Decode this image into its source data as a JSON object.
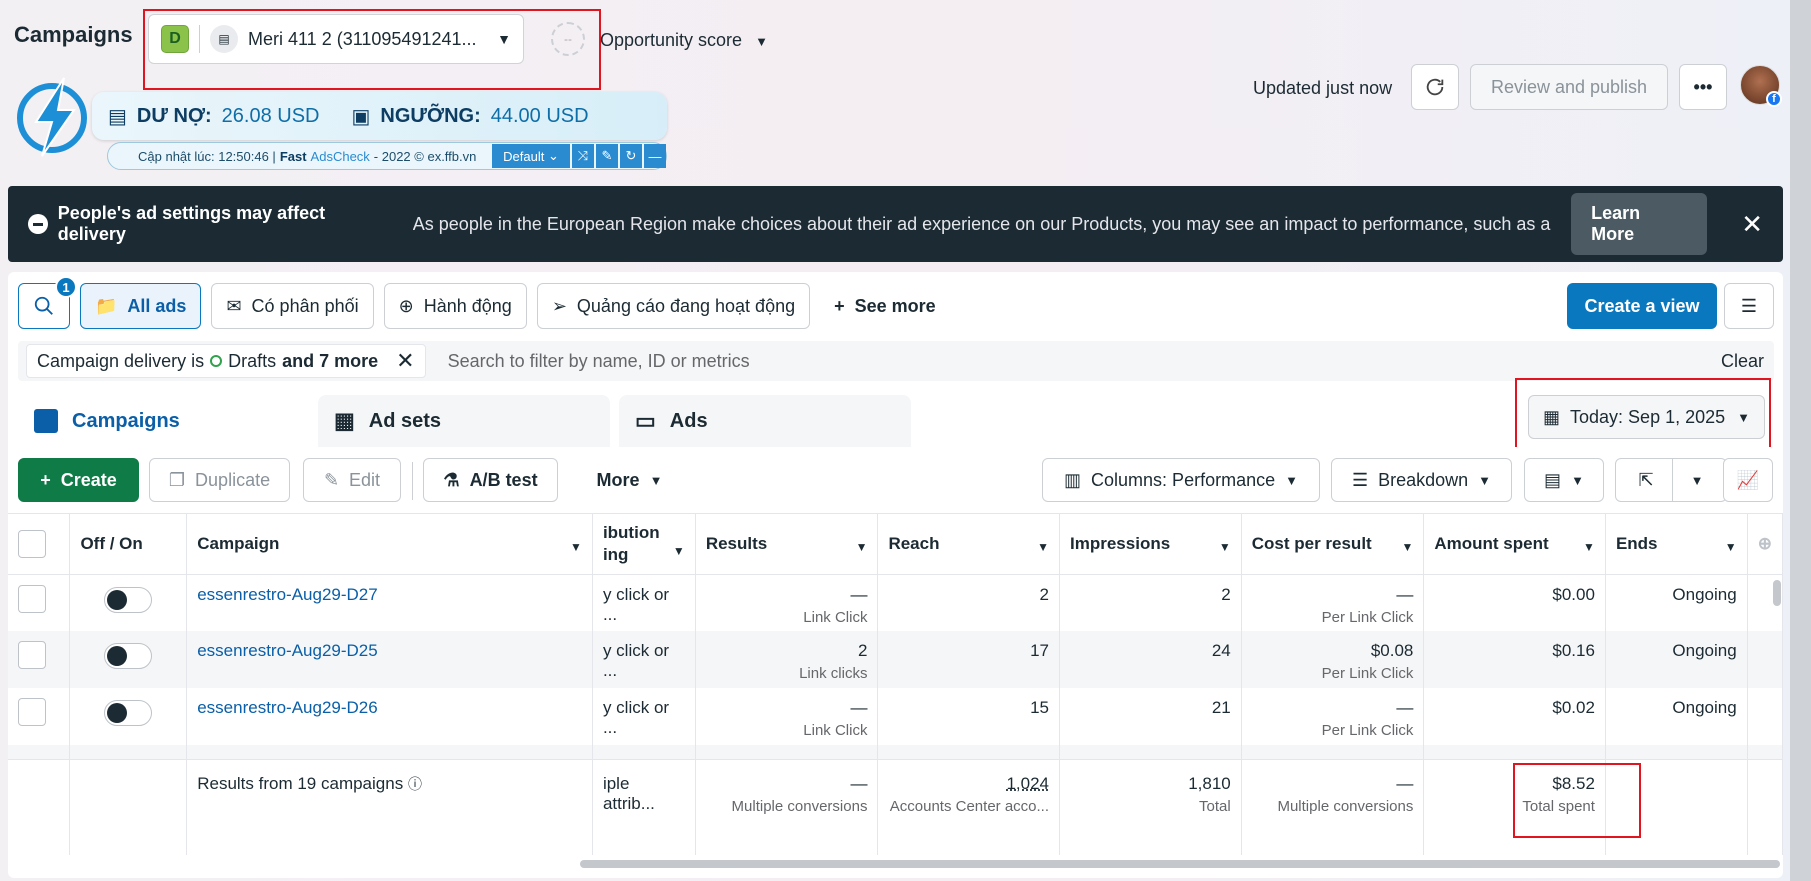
{
  "header": {
    "title": "Campaigns",
    "account": {
      "badge": "D",
      "name": "Meri 411 2 (311095491241..."
    },
    "score_placeholder": "--",
    "opportunity_label": "Opportunity score",
    "updated": "Updated just now",
    "review_label": "Review and publish",
    "more_label": "•••"
  },
  "adscheck": {
    "debt_label": "DƯ NỢ:",
    "debt_value": "26.08 USD",
    "threshold_label": "NGƯỠNG:",
    "threshold_value": "44.00 USD",
    "updated_prefix": "Cập nhật lúc: 12:50:46 |",
    "fast": "Fast",
    "brand": "AdsCheck",
    "suffix": "- 2022 © ex.ffb.vn",
    "preset": "Default"
  },
  "banner": {
    "title": "People's ad settings may affect delivery",
    "message": "As people in the European Region make choices about their ad experience on our Products, you may see an impact to performance, such as a decli...",
    "learn_more": "Learn More"
  },
  "filters": {
    "search_badge": "1",
    "buttons": [
      "All ads",
      "Có phân phối",
      "Hành động",
      "Quảng cáo đang hoạt động"
    ],
    "see_more": "See more",
    "create_view": "Create a view",
    "chip_prefix": "Campaign delivery is",
    "chip_value": "Drafts",
    "chip_more": "and 7 more",
    "search_placeholder": "Search to filter by name, ID or metrics",
    "clear": "Clear"
  },
  "tabs": [
    "Campaigns",
    "Ad sets",
    "Ads"
  ],
  "date_range": "Today: Sep 1, 2025",
  "toolbar": {
    "create": "Create",
    "duplicate": "Duplicate",
    "edit": "Edit",
    "ab_test": "A/B test",
    "more": "More",
    "columns": "Columns: Performance",
    "breakdown": "Breakdown"
  },
  "table": {
    "headers": {
      "toggle": "Off / On",
      "campaign": "Campaign",
      "attribution_1": "ibution",
      "attribution_2": "ing",
      "results": "Results",
      "reach": "Reach",
      "impressions": "Impressions",
      "cpr": "Cost per result",
      "spent": "Amount spent",
      "ends": "Ends"
    },
    "rows": [
      {
        "name": "essenrestro-Aug29-D27",
        "attr": "y click or ...",
        "results": "—",
        "results_sub": "Link Click",
        "reach": "2",
        "impressions": "2",
        "cpr": "—",
        "cpr_sub": "Per Link Click",
        "spent": "$0.00",
        "ends": "Ongoing"
      },
      {
        "name": "essenrestro-Aug29-D25",
        "attr": "y click or ...",
        "results": "2",
        "results_sub": "Link clicks",
        "reach": "17",
        "impressions": "24",
        "cpr": "$0.08",
        "cpr_sub": "Per Link Click",
        "spent": "$0.16",
        "ends": "Ongoing"
      },
      {
        "name": "essenrestro-Aug29-D26",
        "attr": "y click or ...",
        "results": "—",
        "results_sub": "Link Click",
        "reach": "15",
        "impressions": "21",
        "cpr": "—",
        "cpr_sub": "Per Link Click",
        "spent": "$0.02",
        "ends": "Ongoing"
      }
    ],
    "summary": {
      "label": "Results from 19 campaigns",
      "attr": "iple attrib...",
      "results": "—",
      "results_sub": "Multiple conversions",
      "reach": "1,024",
      "reach_sub": "Accounts Center acco...",
      "impressions": "1,810",
      "impressions_sub": "Total",
      "cpr": "—",
      "cpr_sub": "Multiple conversions",
      "spent": "$8.52",
      "spent_sub": "Total spent"
    }
  },
  "colors": {
    "accent": "#0a78be",
    "create_green": "#0f7b47",
    "banner_bg": "#1c2b33",
    "highlight_red": "#e0151f"
  }
}
